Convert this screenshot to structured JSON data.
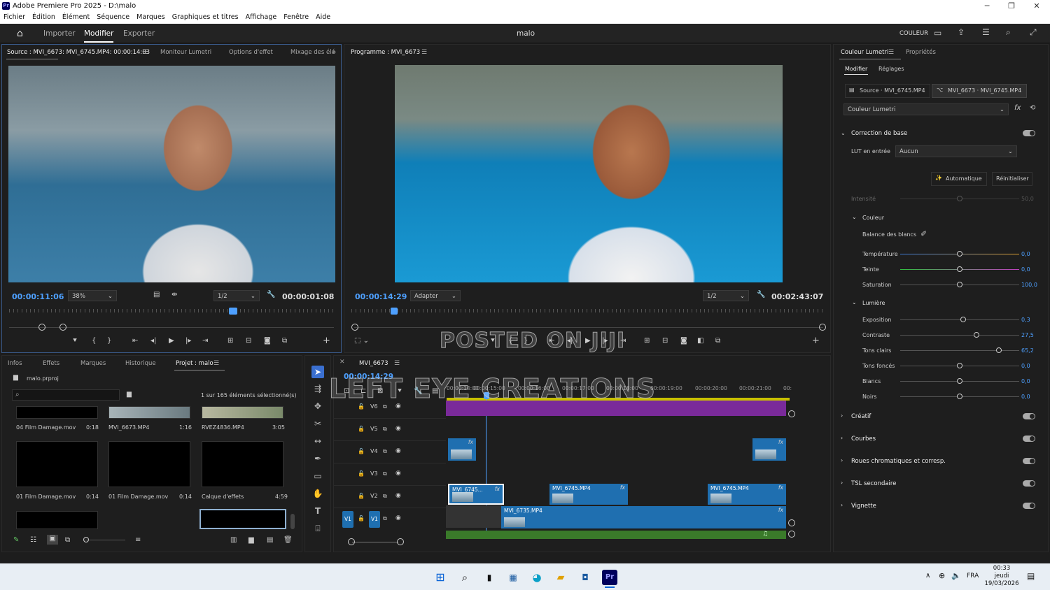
{
  "app": {
    "title": "Adobe Premiere Pro 2025 - D:\\malo",
    "icon_label": "Pr",
    "project": "malo"
  },
  "menu": [
    "Fichier",
    "Édition",
    "Élément",
    "Séquence",
    "Marques",
    "Graphiques et titres",
    "Affichage",
    "Fenêtre",
    "Aide"
  ],
  "workspace": {
    "tabs": [
      "Importer",
      "Modifier",
      "Exporter"
    ],
    "active": "Modifier",
    "right_label": "COULEUR"
  },
  "source_panel": {
    "tabs": [
      "Source : MVI_6673: MVI_6745.MP4: 00:00:14:03",
      "Moniteur Lumetri",
      "Options d'effet",
      "Mixage des élé"
    ],
    "timecode": "00:00:11:06",
    "zoom": "38%",
    "resolution": "1/2",
    "duration": "00:00:01:08"
  },
  "program_panel": {
    "tab": "Programme : MVI_6673",
    "timecode": "00:00:14:29",
    "zoom": "Adapter",
    "resolution": "1/2",
    "duration": "00:02:43:07"
  },
  "project_panel": {
    "tabs": [
      "Infos",
      "Effets",
      "Marques",
      "Historique",
      "Projet : malo"
    ],
    "file": "malo.prproj",
    "count": "1 sur 165 éléments sélectionné(s)",
    "items": [
      {
        "name": "04 Film Damage.mov",
        "dur": "0:18"
      },
      {
        "name": "MVI_6673.MP4",
        "dur": "1:16"
      },
      {
        "name": "RVEZ4836.MP4",
        "dur": "3:05"
      },
      {
        "name": "01 Film Damage.mov",
        "dur": "0:14"
      },
      {
        "name": "01 Film Damage.mov",
        "dur": "0:14"
      },
      {
        "name": "Calque d'effets",
        "dur": "4:59"
      }
    ]
  },
  "timeline": {
    "sequence": "MVI_6673",
    "timecode": "00:00:14:29",
    "ruler": [
      "00:00:14:00",
      "00:00:15:00",
      "00:00:16:00",
      "00:00:17:00",
      "00:00:18:00",
      "00:00:19:00",
      "00:00:20:00",
      "00:00:21:00",
      "00:"
    ],
    "tracks": [
      "V6",
      "V5",
      "V4",
      "V3",
      "V2",
      "V1"
    ],
    "v1_source": "V1",
    "clips": {
      "v2a": "MVI_6745...",
      "v2b": "MVI_6745.MP4",
      "v2c": "MVI_6745.MP4",
      "v1": "MVI_6735.MP4"
    },
    "fx": "fx"
  },
  "lumetri": {
    "tabs": [
      "Couleur Lumetri",
      "Propriétés"
    ],
    "subtabs": [
      "Modifier",
      "Réglages"
    ],
    "source_btn": "Source · MVI_6745.MP4",
    "seq_btn": "MVI_6673 · MVI_6745.MP4",
    "effect": "Couleur Lumetri",
    "basic": "Correction de base",
    "lut_label": "LUT en entrée",
    "lut_value": "Aucun",
    "auto": "Automatique",
    "reset": "Réinitialiser",
    "intensity_label": "Intensité",
    "intensity_value": "50,0",
    "color_section": "Couleur",
    "wb": "Balance des blancs",
    "color_params": [
      {
        "label": "Température",
        "value": "0,0",
        "pos": 0.5
      },
      {
        "label": "Teinte",
        "value": "0,0",
        "pos": 0.5
      },
      {
        "label": "Saturation",
        "value": "100,0",
        "pos": 0.5
      }
    ],
    "light_section": "Lumière",
    "light_params": [
      {
        "label": "Exposition",
        "value": "0,3",
        "pos": 0.53
      },
      {
        "label": "Contraste",
        "value": "27,5",
        "pos": 0.64
      },
      {
        "label": "Tons clairs",
        "value": "65,2",
        "pos": 0.83
      },
      {
        "label": "Tons foncés",
        "value": "0,0",
        "pos": 0.5
      },
      {
        "label": "Blancs",
        "value": "0,0",
        "pos": 0.5
      },
      {
        "label": "Noirs",
        "value": "0,0",
        "pos": 0.5
      }
    ],
    "sections": [
      "Créatif",
      "Courbes",
      "Roues chromatiques et corresp.",
      "TSL secondaire",
      "Vignette"
    ]
  },
  "watermark": {
    "line1": "POSTED ON JIJI",
    "line2": "LEFT EYE CREATIONS"
  },
  "taskbar": {
    "lang": "FRA",
    "time": "00:33",
    "day": "jeudi",
    "date": "19/03/2026"
  },
  "colors": {
    "accent": "#4ea0ff",
    "clip_blue": "#1f6fb0",
    "clip_purple": "#7a2a9a",
    "audio_green": "#3a7a2a"
  }
}
